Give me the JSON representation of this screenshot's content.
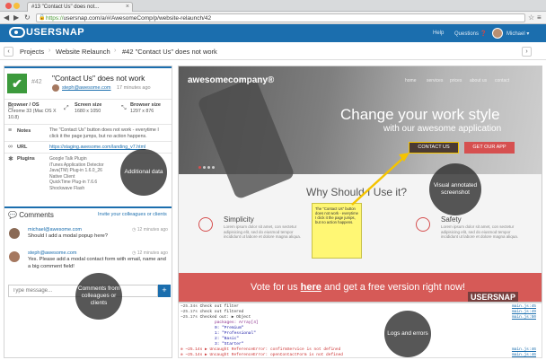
{
  "browser": {
    "tab_title": "#13 \"Contact Us\" does not...",
    "url_prefix": "https://",
    "url": "usersnap.com/a/#/AwesomeComp/p/website-relaunch/42"
  },
  "app_header": {
    "logo_text": "USERSNAP",
    "help": "Help",
    "questions": "Questions",
    "user": "Michael"
  },
  "breadcrumb": {
    "projects": "Projects",
    "project": "Website Relaunch",
    "issue": "#42 \"Contact Us\" does not work"
  },
  "issue": {
    "number": "#42",
    "title": "\"Contact Us\" does not work",
    "reporter": "steph@awesome.com",
    "time": "17 minutes ago"
  },
  "meta": {
    "browser_label": "Browser / OS",
    "browser_value": "Chrome 33 (Mac OS X 10.8)",
    "screen_label": "Screen size",
    "screen_value": "1680 x 1050",
    "bsize_label": "Browser size",
    "bsize_value": "1297 x 876",
    "notes_label": "Notes",
    "notes_value": "The \"Contact Us\" button does not work - everytime I click it the page jumps, but no action happens.",
    "url_label": "URL",
    "url_value": "https://staging.awesome.com/landing_v7.html",
    "plugins_label": "Plugins",
    "plugins": [
      "Google Talk Plugin",
      "iTunes Application Detector",
      "Java(TM) Plug-in 1.6.0_26",
      "Native Client",
      "QuickTime Plug-in 7.6.6",
      "Shockwave Flash"
    ]
  },
  "comments": {
    "title": "Comments",
    "invite": "Invite your colleagues or clients",
    "items": [
      {
        "name": "michael@awesome.com",
        "time": "12 minutes ago",
        "text": "Should I add a modal popup here?"
      },
      {
        "name": "steph@awesome.com",
        "time": "12 minutes ago",
        "text": "Yes. Please add a modal contact form with email, name and a big comment field!"
      }
    ],
    "reply_placeholder": "Type message...",
    "reply_button": "+"
  },
  "screenshot": {
    "site_logo": "awesomecompany®",
    "nav": [
      "home",
      "services",
      "prices",
      "about us",
      "contact"
    ],
    "hero_h1": "Change your work style",
    "hero_h2": "with our awesome application",
    "btn_contact": "CONTACT US",
    "btn_get": "GET OUR APP",
    "why": "Why Should I Use it?",
    "features": [
      {
        "title": "Simplicity",
        "text": "Lorem ipsum dolor sit amet, con sectetur adipisicing elit, sed do eiusmod tempor incididunt ut labore et dolore magna aliqua."
      },
      {
        "title": "Safety",
        "text": "Lorem ipsum dolor sit amet, con sectetur adipisicing elit, sed do eiusmod tempor incididunt ut labore et dolore magna aliqua."
      }
    ],
    "sticky_note": "The \"Contact Us\" button does not work - everytime I click it the page jumps, but no action happens.",
    "vote_pre": "Vote for us ",
    "vote_link": "here",
    "vote_post": " and get a free version right now!",
    "brand": "USERSNAP"
  },
  "logs": [
    {
      "time": "~25.34s",
      "text": "Check out filter",
      "src": "main.js:45"
    },
    {
      "time": "~25.17s",
      "text": "check out filtered",
      "src": "main.js:49"
    },
    {
      "time": "~25.17s",
      "text": "Checked out: ▶ Object",
      "src": "main.js:50"
    },
    {
      "time": "",
      "text": "    packages: Array[4]",
      "src": ""
    },
    {
      "time": "",
      "text": "      0: \"Premium\"",
      "src": ""
    },
    {
      "time": "",
      "text": "      1: \"Professional\"",
      "src": ""
    },
    {
      "time": "",
      "text": "      2: \"Basic\"",
      "src": ""
    },
    {
      "time": "",
      "text": "      3: \"Starter\"",
      "src": ""
    },
    {
      "time": "~25.14s",
      "text": "▶ Uncaught ReferenceError: confirmService is not defined",
      "src": "main.js:46"
    },
    {
      "time": "~25.14s",
      "text": "▶ Uncaught ReferenceError: openContactForm is not defined",
      "src": "main.js:46"
    }
  ],
  "annotations": {
    "additional_data": "Additional data",
    "visual_annotated": "Visual annotated screenshot",
    "comments_from": "Comments from colleagues or clients",
    "logs_errors": "Logs and errors"
  },
  "colors": {
    "brand_blue": "#1b6eae",
    "success_green": "#3c9a3c",
    "accent_red": "#d65050",
    "sticky_yellow": "#fff774"
  }
}
